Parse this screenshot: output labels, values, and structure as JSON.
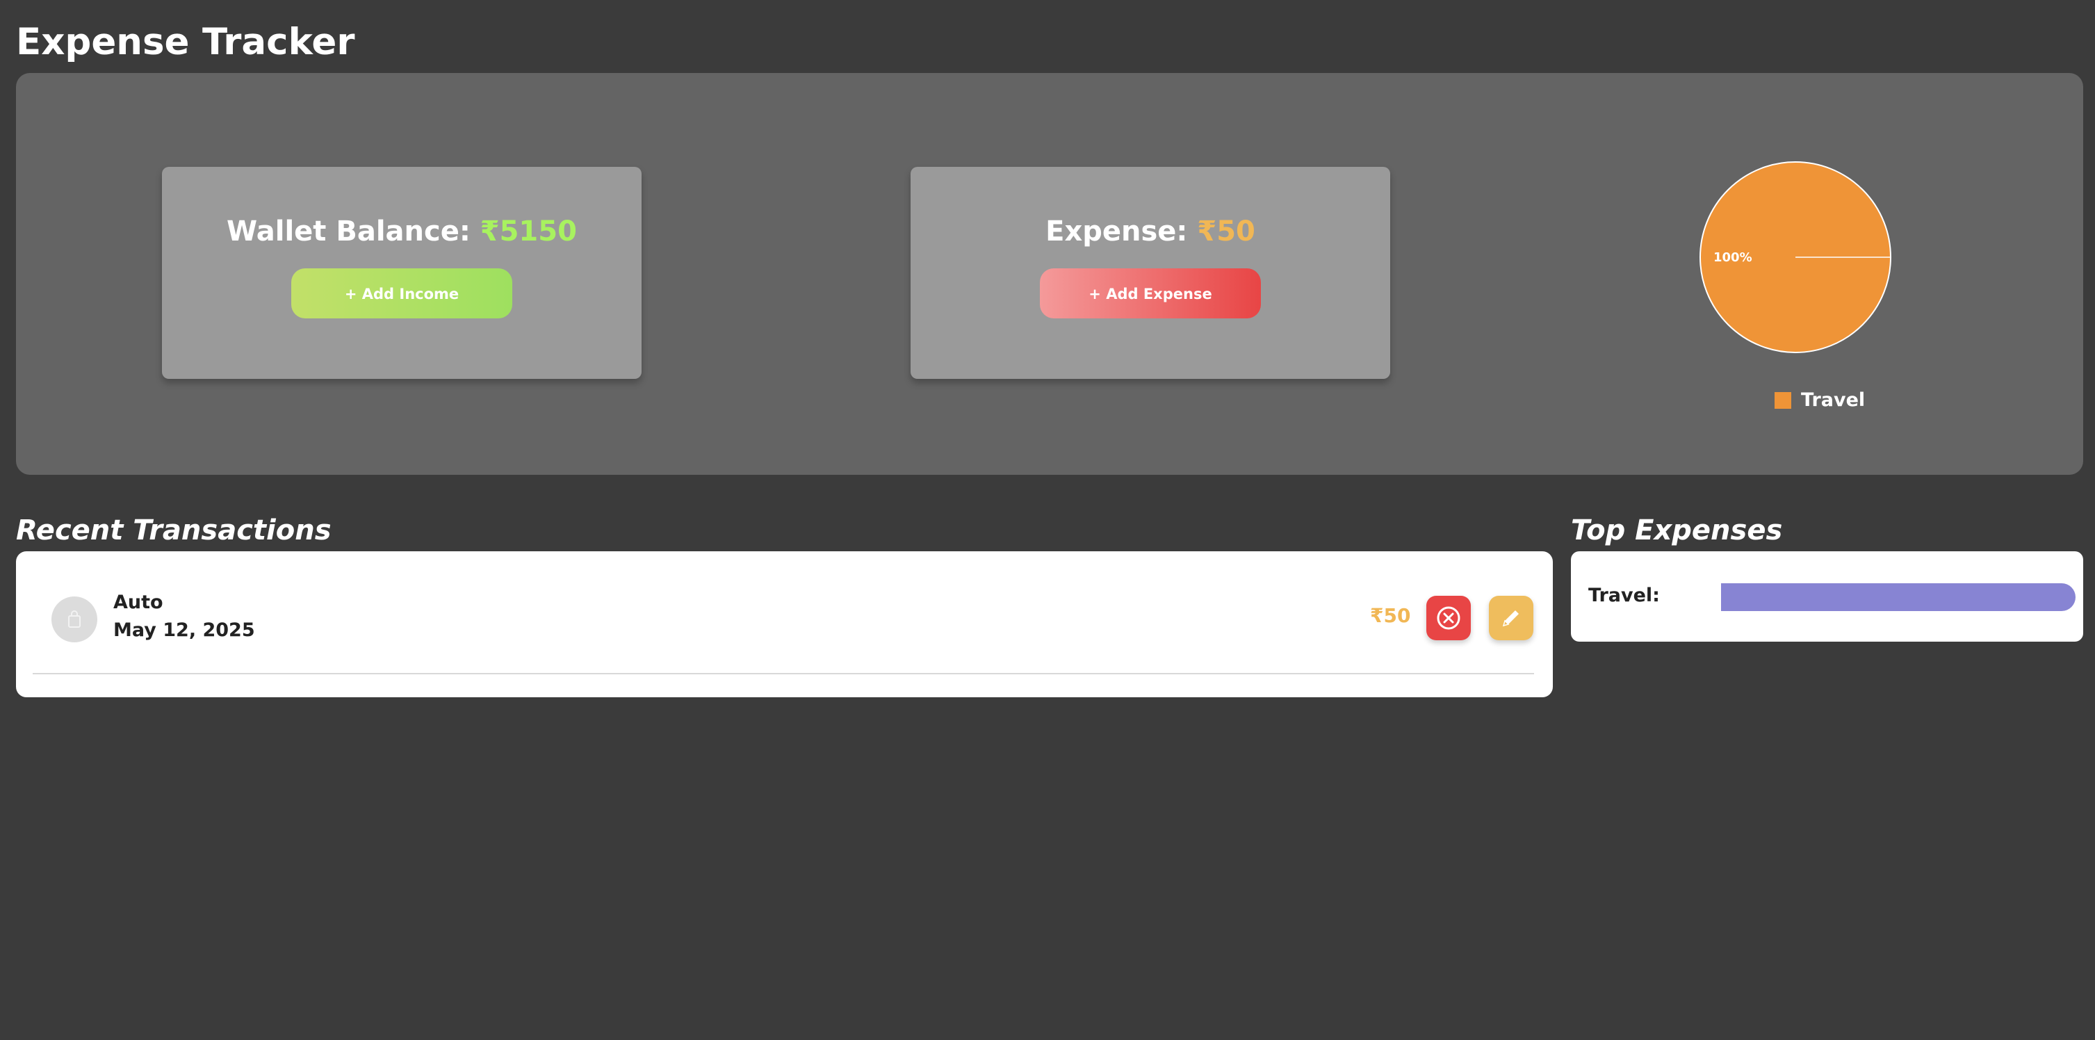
{
  "app": {
    "title": "Expense Tracker"
  },
  "wallet": {
    "label": "Wallet Balance:",
    "amount": "₹5150",
    "button_label": "+ Add Income",
    "accent_color": "#a8f25f"
  },
  "expense": {
    "label": "Expense:",
    "amount": "₹50",
    "button_label": "+ Add Expense",
    "accent_color": "#f1b755"
  },
  "chart_data": [
    {
      "type": "pie",
      "slices": [
        {
          "label": "Travel",
          "value": 100,
          "color": "#ef9437"
        }
      ],
      "data_labels": [
        "100%"
      ],
      "legend": [
        "Travel"
      ],
      "legend_position": "bottom"
    },
    {
      "type": "bar",
      "orientation": "horizontal",
      "categories": [
        "Travel:"
      ],
      "values": [
        50
      ],
      "xlim": [
        0,
        50
      ],
      "color": "#8784d3"
    }
  ],
  "recent_transactions": {
    "heading": "Recent Transactions",
    "items": [
      {
        "name": "Auto",
        "date": "May 12, 2025",
        "amount": "₹50",
        "icon": "shopping-bag-icon"
      }
    ]
  },
  "top_expenses": {
    "heading": "Top Expenses"
  }
}
